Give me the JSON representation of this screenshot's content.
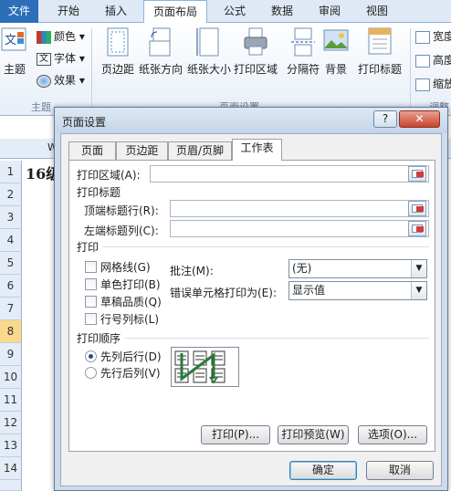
{
  "ribbon": {
    "tabs": [
      {
        "label": "文件"
      },
      {
        "label": "开始"
      },
      {
        "label": "插入"
      },
      {
        "label": "页面布局"
      },
      {
        "label": "公式"
      },
      {
        "label": "数据"
      },
      {
        "label": "审阅"
      },
      {
        "label": "视图"
      }
    ],
    "active_tab": "页面布局",
    "themes": {
      "label": "主题",
      "colors": "颜色",
      "fonts": "字体",
      "effects": "效果",
      "group": "主题"
    },
    "page_setup": {
      "margins": "页边距",
      "orientation": "纸张方向",
      "size": "纸张大小",
      "print_area": "打印区域",
      "breaks": "分隔符",
      "background": "背景",
      "print_titles": "打印标题",
      "group": "页面设置"
    },
    "scale": {
      "width": "宽度",
      "height": "高度",
      "scale": "缩放",
      "group": "调整"
    }
  },
  "sheet": {
    "rows": [
      "1",
      "2",
      "3",
      "4",
      "5",
      "6",
      "7",
      "8",
      "9",
      "10",
      "11",
      "12",
      "13",
      "14"
    ],
    "selected_row": "8",
    "a1_text": "16级",
    "col_partial": "W"
  },
  "dialog": {
    "title": "页面设置",
    "help": "?",
    "close": "✕",
    "tabs": [
      "页面",
      "页边距",
      "页眉/页脚",
      "工作表"
    ],
    "active_tab": "工作表",
    "print_area_label": "打印区域(A):",
    "print_titles_label": "打印标题",
    "rows_to_repeat_label": "顶端标题行(R):",
    "cols_to_repeat_label": "左端标题列(C):",
    "print_section": "打印",
    "gridlines": "网格线(G)",
    "black_white": "单色打印(B)",
    "draft_quality": "草稿品质(Q)",
    "row_col_headings": "行号列标(L)",
    "comments_label": "批注(M):",
    "comments_value": "(无)",
    "cell_errors_label": "错误单元格打印为(E):",
    "cell_errors_value": "显示值",
    "page_order": "打印顺序",
    "down_then_over": "先列后行(D)",
    "over_then_down": "先行后列(V)",
    "print_btn": "打印(P)...",
    "preview_btn": "打印预览(W)",
    "options_btn": "选项(O)...",
    "ok_btn": "确定",
    "cancel_btn": "取消"
  }
}
